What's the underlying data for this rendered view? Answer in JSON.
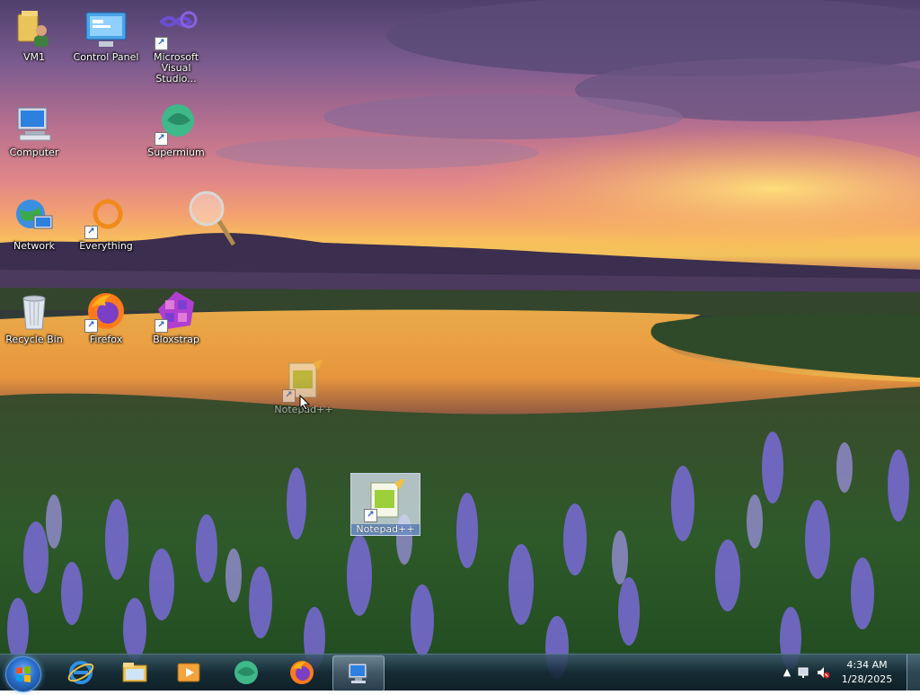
{
  "desktop": {
    "icons": [
      {
        "label": "VM1"
      },
      {
        "label": "Control Panel"
      },
      {
        "label": "Microsoft Visual Studio..."
      },
      {
        "label": "Computer"
      },
      {
        "label": "Supermium"
      },
      {
        "label": "Network"
      },
      {
        "label": "Everything"
      },
      {
        "label": "Recycle Bin"
      },
      {
        "label": "Firefox"
      },
      {
        "label": "Bloxstrap"
      },
      {
        "label": "Notepad++"
      }
    ],
    "drag_ghost": {
      "label": "Notepad++"
    }
  },
  "taskbar": {
    "pinned": [
      {
        "icon": "internet-explorer-icon"
      },
      {
        "icon": "windows-explorer-icon"
      },
      {
        "icon": "media-player-icon"
      },
      {
        "icon": "supermium-icon"
      },
      {
        "icon": "firefox-icon"
      },
      {
        "icon": "remote-desktop-icon"
      }
    ],
    "clock": {
      "time": "4:34 AM",
      "date": "1/28/2025"
    }
  },
  "colors": {
    "taskbar": "#1c3444",
    "selection": "#dce6f5",
    "accent": "#2b6fcc"
  }
}
